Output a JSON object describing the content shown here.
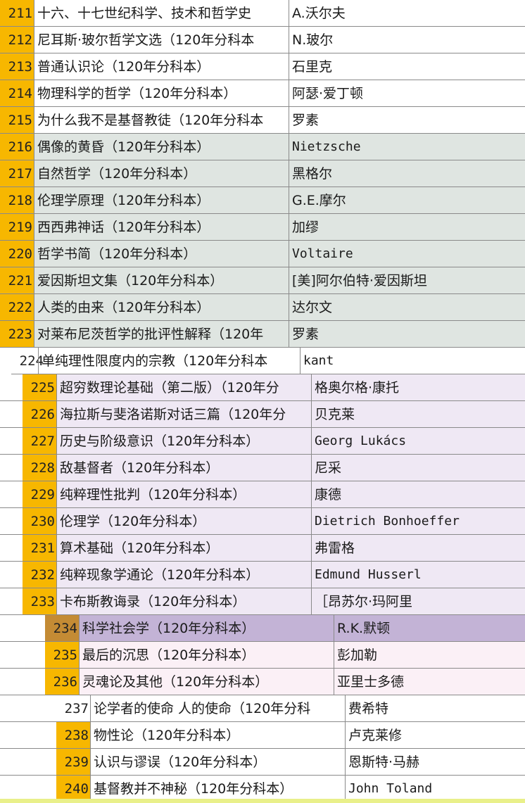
{
  "rows": [
    {
      "no": "211",
      "title": "十六、十七世纪科学、技术和哲学史",
      "author": "A.沃尔夫"
    },
    {
      "no": "212",
      "title": "尼耳斯·玻尔哲学文选（120年分科本",
      "author": "N.玻尔"
    },
    {
      "no": "213",
      "title": "普通认识论（120年分科本）",
      "author": "石里克"
    },
    {
      "no": "214",
      "title": "物理科学的哲学（120年分科本）",
      "author": "阿瑟·爱丁顿"
    },
    {
      "no": "215",
      "title": "为什么我不是基督教徒（120年分科本",
      "author": "罗素"
    },
    {
      "no": "216",
      "title": "偶像的黄昏（120年分科本）",
      "author": "Nietzsche"
    },
    {
      "no": "217",
      "title": "自然哲学（120年分科本）",
      "author": "黑格尔"
    },
    {
      "no": "218",
      "title": "伦理学原理（120年分科本）",
      "author": "G.E.摩尔"
    },
    {
      "no": "219",
      "title": "西西弗神话（120年分科本）",
      "author": "加缪"
    },
    {
      "no": "220",
      "title": "哲学书简（120年分科本）",
      "author": "Voltaire"
    },
    {
      "no": "221",
      "title": "爱因斯坦文集（120年分科本）",
      "author": "[美]阿尔伯特·爱因斯坦"
    },
    {
      "no": "222",
      "title": "人类的由来（120年分科本）",
      "author": "达尔文"
    },
    {
      "no": "223",
      "title": "对莱布尼茨哲学的批评性解释（120年",
      "author": "罗素"
    },
    {
      "no": "224",
      "title": "单纯理性限度内的宗教（120年分科本",
      "author": "kant"
    },
    {
      "no": "225",
      "title": "超穷数理论基础（第二版）（120年分",
      "author": "格奥尔格·康托"
    },
    {
      "no": "226",
      "title": "海拉斯与斐洛诺斯对话三篇（120年分",
      "author": "贝克莱"
    },
    {
      "no": "227",
      "title": "历史与阶级意识（120年分科本）",
      "author": "Georg Lukács"
    },
    {
      "no": "228",
      "title": "敌基督者（120年分科本）",
      "author": "尼采"
    },
    {
      "no": "229",
      "title": "纯粹理性批判（120年分科本）",
      "author": "康德"
    },
    {
      "no": "230",
      "title": "伦理学（120年分科本）",
      "author": "Dietrich Bonhoeffer"
    },
    {
      "no": "231",
      "title": "算术基础（120年分科本）",
      "author": "弗雷格"
    },
    {
      "no": "232",
      "title": "纯粹现象学通论（120年分科本）",
      "author": "Edmund Husserl"
    },
    {
      "no": "233",
      "title": "卡布斯教诲录（120年分科本）",
      "author": "［昂苏尔·玛阿里"
    },
    {
      "no": "234",
      "title": "科学社会学（120年分科本）",
      "author": "R.K.默顿"
    },
    {
      "no": "235",
      "title": "最后的沉思（120年分科本）",
      "author": "彭加勒"
    },
    {
      "no": "236",
      "title": "灵魂论及其他（120年分科本）",
      "author": "亚里士多德"
    },
    {
      "no": "237",
      "title": "论学者的使命 人的使命（120年分科",
      "author": "费希特"
    },
    {
      "no": "238",
      "title": "物性论（120年分科本）",
      "author": "卢克莱修"
    },
    {
      "no": "239",
      "title": "认识与谬误（120年分科本）",
      "author": "恩斯特·马赫"
    },
    {
      "no": "240",
      "title": "基督教并不神秘（120年分科本）",
      "author": "John Toland"
    }
  ]
}
